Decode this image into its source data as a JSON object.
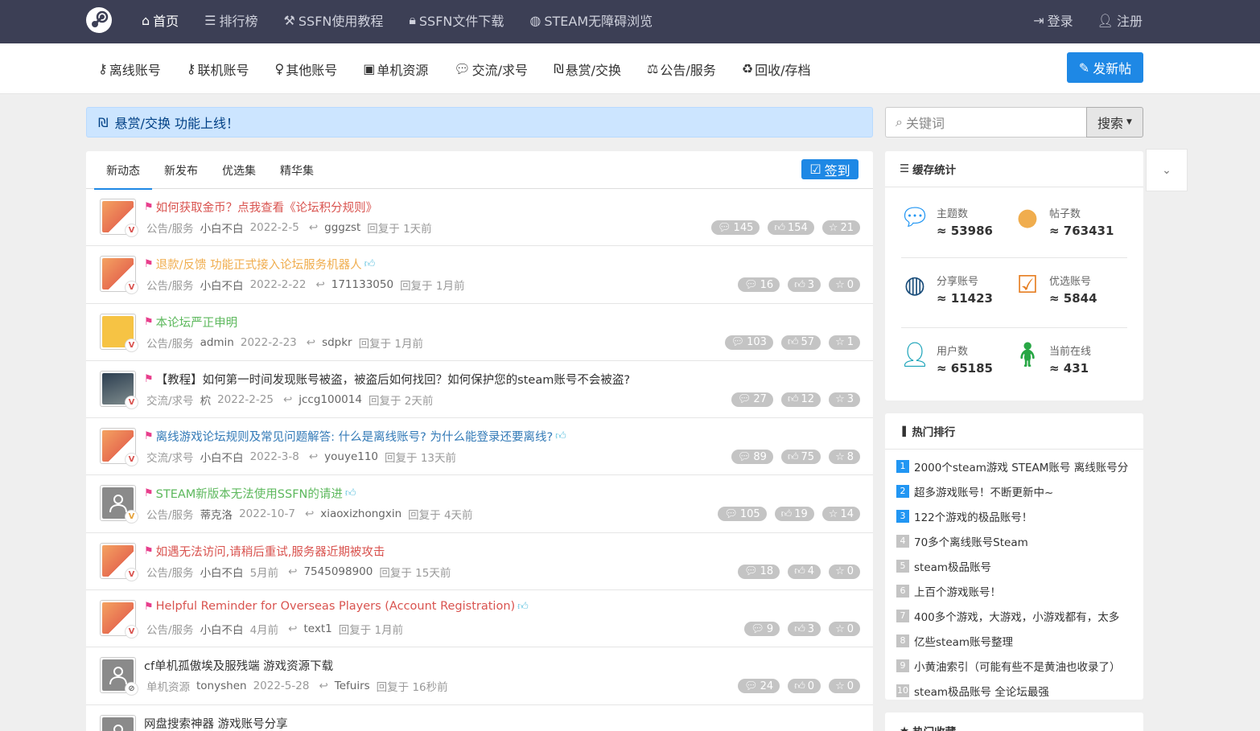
{
  "topnav": {
    "items": [
      {
        "label": "首页",
        "icon": "home-icon",
        "active": true
      },
      {
        "label": "排行榜",
        "icon": "list-icon"
      },
      {
        "label": "SSFN使用教程",
        "icon": "wrench-icon"
      },
      {
        "label": "SSFN文件下载",
        "icon": "lock-icon"
      },
      {
        "label": "STEAM无障碍浏览",
        "icon": "steam-icon"
      }
    ],
    "login": "登录",
    "register": "注册"
  },
  "subnav": {
    "items": [
      {
        "label": "离线账号",
        "icon": "key-icon"
      },
      {
        "label": "联机账号",
        "icon": "key-icon"
      },
      {
        "label": "其他账号",
        "icon": "user-icon"
      },
      {
        "label": "单机资源",
        "icon": "gamepad-icon"
      },
      {
        "label": "交流/求号",
        "icon": "comment-icon"
      },
      {
        "label": "悬赏/交换",
        "icon": "shekel-icon"
      },
      {
        "label": "公告/服务",
        "icon": "scale-icon"
      },
      {
        "label": "回收/存档",
        "icon": "recycle-icon"
      }
    ],
    "new_post": "发新帖"
  },
  "notice": {
    "text": "悬赏/交换 功能上线！"
  },
  "search": {
    "placeholder": "关键词",
    "button": "搜索"
  },
  "tabs": {
    "items": [
      "新动态",
      "新发布",
      "优选集",
      "精华集"
    ],
    "checkin": "签到"
  },
  "threads": [
    {
      "title": "如何获取金币？点我查看《论坛积分规则》",
      "color": "#d9534f",
      "thumb": false,
      "category": "公告/服务",
      "author": "小白不白",
      "date": "2022-2-5",
      "last_reply": "gggzst",
      "reply_time": "回复于 1天前",
      "comments": "145",
      "likes": "154",
      "stars": "21",
      "avatar": "cat"
    },
    {
      "title": "退款/反馈 功能正式接入论坛服务机器人",
      "color": "#f0ad4e",
      "thumb": true,
      "category": "公告/服务",
      "author": "小白不白",
      "date": "2022-2-22",
      "last_reply": "171133050",
      "reply_time": "回复于 1月前",
      "comments": "16",
      "likes": "3",
      "stars": "0",
      "avatar": "cat"
    },
    {
      "title": "本论坛严正申明",
      "color": "#5cb85c",
      "thumb": false,
      "category": "公告/服务",
      "author": "admin",
      "date": "2022-2-23",
      "last_reply": "sdpkr",
      "reply_time": "回复于 1月前",
      "comments": "103",
      "likes": "57",
      "stars": "1",
      "avatar": "emoji"
    },
    {
      "title": "【教程】如何第一时间发现账号被盗，被盗后如何找回？如何保护您的steam账号不会被盗?",
      "color": "#333333",
      "thumb": false,
      "category": "交流/求号",
      "author": "柼",
      "date": "2022-2-25",
      "last_reply": "jccg100014",
      "reply_time": "回复于 2天前",
      "comments": "27",
      "likes": "12",
      "stars": "3",
      "avatar": "dark"
    },
    {
      "title": "离线游戏论坛规则及常见问题解答: 什么是离线账号? 为什么能登录还要离线?",
      "color": "#337ab7",
      "thumb": true,
      "category": "交流/求号",
      "author": "小白不白",
      "date": "2022-3-8",
      "last_reply": "youye110",
      "reply_time": "回复于 13天前",
      "comments": "89",
      "likes": "75",
      "stars": "8",
      "avatar": "cat"
    },
    {
      "title": "STEAM新版本无法使用SSFN的请进",
      "color": "#5cb85c",
      "thumb": true,
      "category": "公告/服务",
      "author": "蒂克洛",
      "date": "2022-10-7",
      "last_reply": "xiaoxizhongxin",
      "reply_time": "回复于 4天前",
      "comments": "105",
      "likes": "19",
      "stars": "14",
      "avatar": "gray"
    },
    {
      "title": "如遇无法访问,请稍后重试,服务器近期被攻击",
      "color": "#d9534f",
      "thumb": false,
      "category": "公告/服务",
      "author": "小白不白",
      "date": "5月前",
      "last_reply": "7545098900",
      "reply_time": "回复于 15天前",
      "comments": "18",
      "likes": "4",
      "stars": "0",
      "avatar": "cat"
    },
    {
      "title": "Helpful Reminder for Overseas Players (Account Registration)",
      "color": "#d9534f",
      "thumb": true,
      "category": "公告/服务",
      "author": "小白不白",
      "date": "4月前",
      "last_reply": "text1",
      "reply_time": "回复于 1月前",
      "comments": "9",
      "likes": "3",
      "stars": "0",
      "avatar": "cat"
    },
    {
      "title": "cf单机孤傲埃及服残端 游戏资源下载",
      "color": "#333333",
      "thumb": false,
      "flag": false,
      "category": "单机资源",
      "author": "tonyshen",
      "date": "2022-5-28",
      "last_reply": "Tefuirs",
      "reply_time": "回复于 16秒前",
      "comments": "24",
      "likes": "0",
      "stars": "0",
      "avatar": "gray"
    },
    {
      "title": "网盘搜索神器 游戏账号分享",
      "color": "#333333",
      "thumb": false,
      "flag": false,
      "category": "",
      "author": "",
      "date": "",
      "last_reply": "",
      "reply_time": "",
      "comments": "",
      "likes": "",
      "stars": "",
      "avatar": "gray"
    }
  ],
  "stats": {
    "title": "缓存统计",
    "items": [
      {
        "label": "主题数",
        "value": "≈ 53986",
        "icon": "comments-icon",
        "color": "#2196f3"
      },
      {
        "label": "帖子数",
        "value": "≈ 763431",
        "icon": "chat-bubble-icon",
        "color": "#f0ad4e"
      },
      {
        "label": "分享账号",
        "value": "≈ 11423",
        "icon": "steam-icon",
        "color": "#1a4d7a"
      },
      {
        "label": "优选账号",
        "value": "≈ 5844",
        "icon": "check-square-icon",
        "color": "#e67e22"
      },
      {
        "label": "用户数",
        "value": "≈ 65185",
        "icon": "user-icon",
        "color": "#17a2b8"
      },
      {
        "label": "当前在线",
        "value": "≈ 431",
        "icon": "child-icon",
        "color": "#28a745"
      }
    ]
  },
  "hot": {
    "title": "热门排行",
    "items": [
      "2000个steam游戏 STEAM账号 离线账号分",
      "超多游戏账号！不断更新中~",
      "122个游戏的极品账号！",
      "70多个离线账号Steam",
      "steam极品账号",
      "上百个游戏账号！",
      "400多个游戏，大游戏，小游戏都有，太多",
      "亿些steam账号整理",
      "小黄油索引（可能有些不是黄油也收录了）",
      "steam极品账号 全论坛最强"
    ]
  },
  "fav": {
    "title": "热门收藏"
  }
}
